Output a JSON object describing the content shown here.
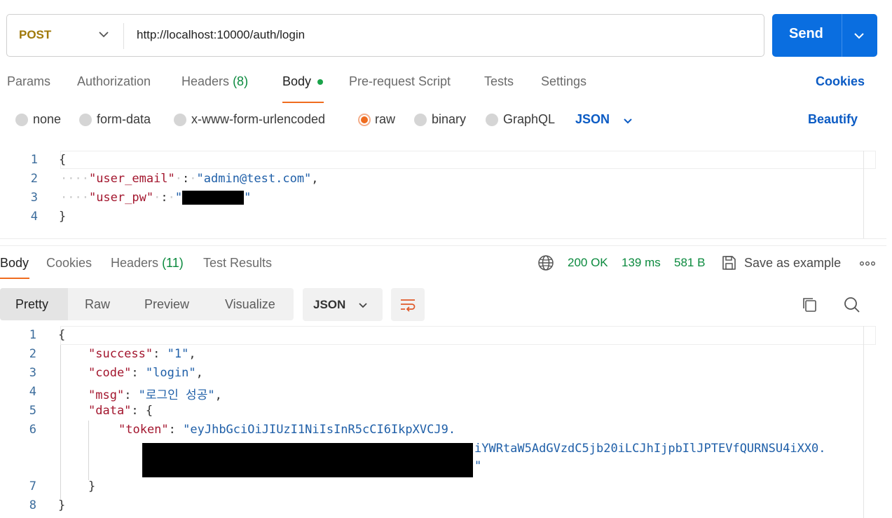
{
  "request": {
    "method": "POST",
    "url": "http://localhost:10000/auth/login",
    "send_label": "Send"
  },
  "request_tabs": {
    "params": "Params",
    "authorization": "Authorization",
    "headers": "Headers",
    "headers_count": "(8)",
    "body": "Body",
    "pre_request": "Pre-request Script",
    "tests": "Tests",
    "settings": "Settings",
    "cookies": "Cookies"
  },
  "body_types": {
    "none": "none",
    "form_data": "form-data",
    "urlencoded": "x-www-form-urlencoded",
    "raw": "raw",
    "binary": "binary",
    "graphql": "GraphQL",
    "selected": "raw",
    "language": "JSON",
    "beautify": "Beautify"
  },
  "request_body": {
    "line_numbers": [
      "1",
      "2",
      "3",
      "4"
    ],
    "open_brace": "{",
    "close_brace": "}",
    "ws_indent": "····",
    "email_key": "\"user_email\"",
    "email_sep_a": "·",
    "colon": ":",
    "email_sep_b": "·",
    "email_value": "\"admin@test.com\"",
    "comma": ",",
    "pw_key": "\"user_pw\"",
    "pw_sep_a": "·",
    "pw_sep_b": "·",
    "pw_value_open": "\"",
    "pw_value_close": "\""
  },
  "response_tabs": {
    "body": "Body",
    "cookies": "Cookies",
    "headers": "Headers",
    "headers_count": "(11)",
    "test_results": "Test Results"
  },
  "response_status": {
    "status": "200 OK",
    "time": "139 ms",
    "size": "581 B",
    "save_example": "Save as example"
  },
  "view_modes": {
    "pretty": "Pretty",
    "raw": "Raw",
    "preview": "Preview",
    "visualize": "Visualize",
    "format": "JSON"
  },
  "response_body": {
    "line_numbers": [
      "1",
      "2",
      "3",
      "4",
      "5",
      "6",
      "7",
      "8"
    ],
    "open_brace": "{",
    "close_brace": "}",
    "success_key": "\"success\"",
    "success_value": "\"1\"",
    "code_key": "\"code\"",
    "code_value": "\"login\"",
    "msg_key": "\"msg\"",
    "msg_value": "\"로그인 성공\"",
    "data_key": "\"data\"",
    "data_open": "{",
    "token_key": "\"token\"",
    "token_part1": "\"eyJhbGciOiJIUzI1NiIsInR5cCI6IkpXVCJ9.",
    "token_part2": "iYWRtaW5AdGVzdC5jb20iLCJhIjpbIlJPTEVfQURNSU4iXX0.",
    "token_close": "\"",
    "data_close": "}",
    "colon_space": ": ",
    "comma": ","
  },
  "colors": {
    "accent": "#0a6ee0",
    "method": "#a0790a",
    "tab_underline": "#ef6c1f",
    "status_ok": "#0b8a3e",
    "json_key": "#a3162e",
    "json_string": "#1f5fa8"
  },
  "icons": [
    "chevron-down-icon",
    "globe-icon",
    "save-icon",
    "more-icon",
    "wrap-lines-icon",
    "copy-icon",
    "search-icon"
  ]
}
